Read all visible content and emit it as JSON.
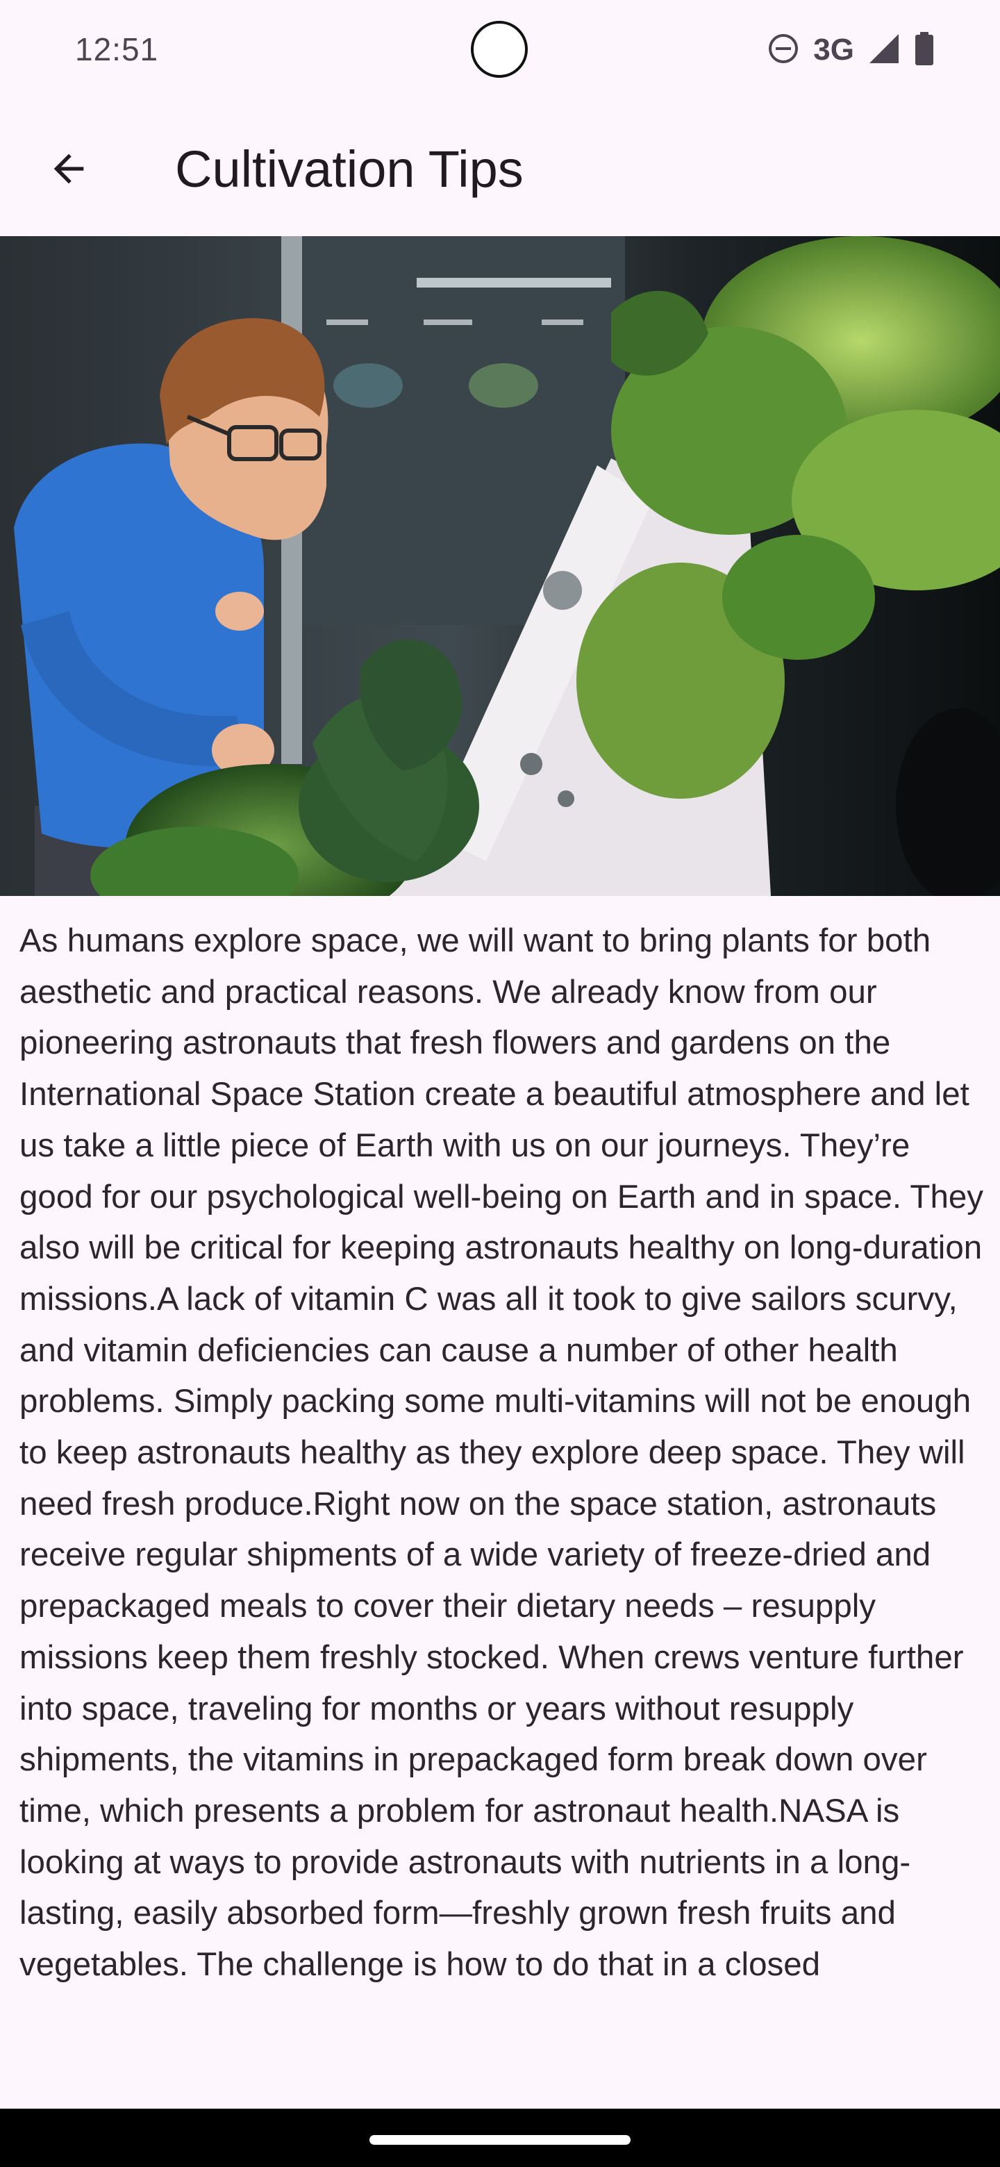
{
  "status_bar": {
    "time": "12:51",
    "network": "3G",
    "icons": [
      "do-not-disturb-icon",
      "signal-icon",
      "battery-icon"
    ]
  },
  "app_bar": {
    "title": "Cultivation Tips",
    "back_icon": "arrow-back-icon"
  },
  "article": {
    "body": "As humans explore space, we will want to bring plants for both aesthetic and practical reasons. We already know from our pioneering astronauts that fresh flowers and gardens on the International Space Station create a beautiful atmosphere and let us take a little piece of Earth with us on our journeys. They’re good for our psychological well-being on Earth and in space. They also will be critical for keeping astronauts healthy on long-duration missions.A lack of vitamin C was all it took to give sailors scurvy, and vitamin deficiencies can cause a number of other health problems. Simply packing some multi-vitamins will not be enough to keep astronauts healthy as they explore deep space. They will need fresh produce.Right now on the space station, astronauts receive regular shipments of a wide variety of freeze-dried and prepackaged meals to cover their dietary needs – resupply missions keep them freshly stocked. When crews venture further into space, traveling for months or years without resupply shipments, the vitamins in prepackaged form break down over time, which presents a problem for astronaut health.NASA is looking at ways to provide astronauts with nutrients in a long-lasting, easily absorbed form—freshly grown fresh fruits and vegetables. The challenge is how to do that in a closed"
  },
  "colors": {
    "background": "#fdf7fd",
    "text": "#2a262c",
    "title": "#1f1b20",
    "status_icons": "#4a4550",
    "nav_bar": "#000000"
  }
}
